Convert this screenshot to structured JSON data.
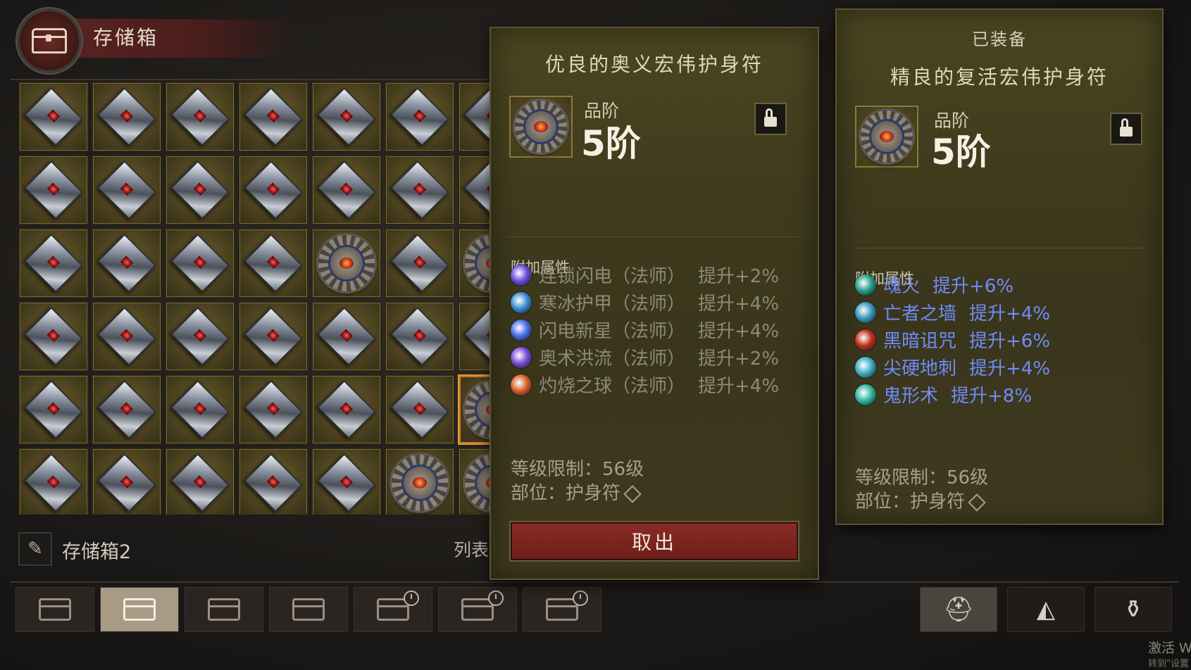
{
  "header": {
    "title": "存储箱",
    "icon": "chest-icon"
  },
  "grid": {
    "rows": [
      [
        "gem",
        "gem",
        "gem",
        "gem",
        "gem",
        "gem",
        "gem"
      ],
      [
        "gem",
        "gem",
        "gem",
        "gem",
        "gem",
        "gem",
        "gem"
      ],
      [
        "gem",
        "gem",
        "gem",
        "gem",
        "amulet",
        "gem",
        "amulet"
      ],
      [
        "gem",
        "gem",
        "gem",
        "gem",
        "gem",
        "gem",
        "gem"
      ],
      [
        "gem",
        "gem",
        "gem",
        "gem",
        "gem",
        "gem",
        "amulet-selected"
      ],
      [
        "gem",
        "gem",
        "gem",
        "gem",
        "gem",
        "amulet",
        "amulet"
      ]
    ]
  },
  "stash": {
    "name": "存储箱2",
    "list_label": "列表"
  },
  "tabs": [
    {
      "icon": "chest-icon",
      "active": false,
      "timed": false
    },
    {
      "icon": "chest-icon",
      "active": true,
      "timed": false
    },
    {
      "icon": "chest-icon",
      "active": false,
      "timed": false
    },
    {
      "icon": "chest-icon",
      "active": false,
      "timed": false
    },
    {
      "icon": "chest-icon",
      "active": false,
      "timed": true
    },
    {
      "icon": "chest-icon",
      "active": false,
      "timed": true
    },
    {
      "icon": "chest-icon",
      "active": false,
      "timed": true
    }
  ],
  "right_tabs": [
    {
      "icon": "helmet-icon",
      "glyph": "⛑",
      "active": true
    },
    {
      "icon": "ore-icon",
      "glyph": "◭",
      "active": false
    },
    {
      "icon": "bag-icon",
      "glyph": "⚱",
      "active": false
    }
  ],
  "tooltip_selected": {
    "name": "优良的奥义宏伟护身符",
    "tier_label": "品阶",
    "tier_value": "5阶",
    "section_label": "附加属性",
    "affixes": [
      {
        "skill": "连锁闪电（法师）",
        "boost": "提升+2%",
        "color": "#6a4fe0"
      },
      {
        "skill": "寒冰护甲（法师）",
        "boost": "提升+4%",
        "color": "#3c8fd6"
      },
      {
        "skill": "闪电新星（法师）",
        "boost": "提升+4%",
        "color": "#4a6ee8"
      },
      {
        "skill": "奥术洪流（法师）",
        "boost": "提升+2%",
        "color": "#7b4fd8"
      },
      {
        "skill": "灼烧之球（法师）",
        "boost": "提升+4%",
        "color": "#d9612a"
      }
    ],
    "level_req": "等级限制：56级",
    "slot": "部位：护身符",
    "take_button": "取出"
  },
  "tooltip_equipped": {
    "equipped_label": "已装备",
    "name": "精良的复活宏伟护身符",
    "tier_label": "品阶",
    "tier_value": "5阶",
    "section_label": "附加属性",
    "affixes": [
      {
        "skill": "魂火",
        "boost": "提升+6%",
        "color": "#2aa08a"
      },
      {
        "skill": "亡者之墙",
        "boost": "提升+4%",
        "color": "#3a9abc"
      },
      {
        "skill": "黑暗诅咒",
        "boost": "提升+6%",
        "color": "#c0311e"
      },
      {
        "skill": "尖硬地刺",
        "boost": "提升+4%",
        "color": "#3fb0c6"
      },
      {
        "skill": "鬼形术",
        "boost": "提升+8%",
        "color": "#32b8a0"
      }
    ],
    "level_req": "等级限制：56级",
    "slot": "部位：护身符"
  },
  "watermark": {
    "line1": "激活 W",
    "line2": "转到\"设置"
  },
  "colors": {
    "affix_active": "#6f8cf7",
    "affix_inactive": "#8d8978",
    "button": "#7c251f"
  }
}
